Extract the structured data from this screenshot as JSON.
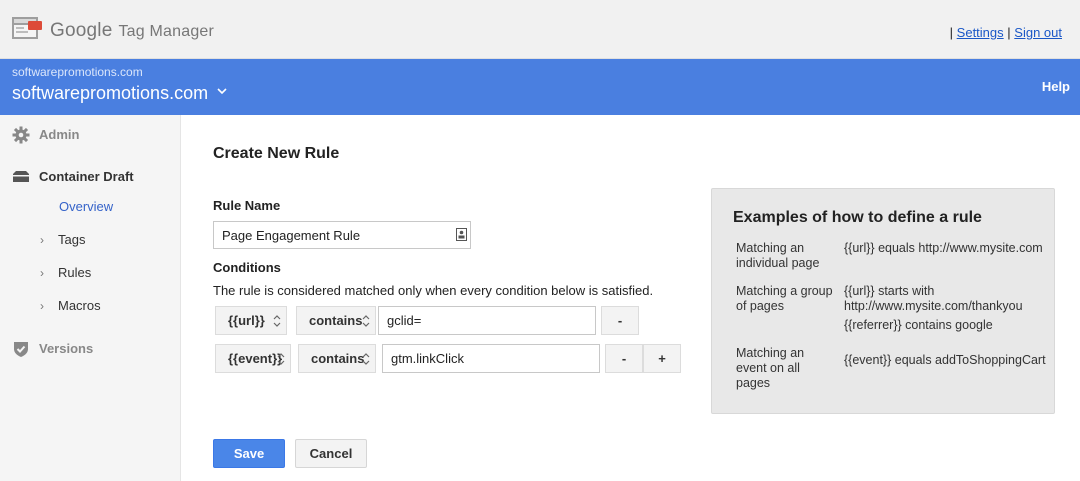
{
  "topbar": {
    "brand_google": "Google",
    "brand_product": "Tag Manager",
    "separator": "|",
    "settings_link": "Settings",
    "signout_link": "Sign out"
  },
  "account": {
    "small_name": "softwarepromotions.com",
    "container_name": "softwarepromotions.com",
    "help": "Help",
    "colors": {
      "bar": "#4a7fe0"
    }
  },
  "sidebar": {
    "admin": "Admin",
    "container_draft": "Container Draft",
    "overview": "Overview",
    "tags": "Tags",
    "rules": "Rules",
    "macros": "Macros",
    "versions": "Versions"
  },
  "main": {
    "title": "Create New Rule",
    "rule_name_label": "Rule Name",
    "rule_name_value": "Page Engagement Rule",
    "conditions_label": "Conditions",
    "conditions_desc": "The rule is considered matched only when every condition below is satisfied.",
    "conditions": [
      {
        "variable": "{{url}}",
        "operator": "contains",
        "value": "gclid=",
        "remove": "-"
      },
      {
        "variable": "{{event}}",
        "operator": "contains",
        "value": "gtm.linkClick",
        "remove": "-",
        "add": "+"
      }
    ],
    "save": "Save",
    "cancel": "Cancel"
  },
  "examples": {
    "title": "Examples of how to define a rule",
    "rows": [
      {
        "label": "Matching an individual page",
        "rule1": "{{url}} equals http://www.mysite.com"
      },
      {
        "label": "Matching a group of pages",
        "rule1": "{{url}} starts with http://www.mysite.com/thankyou",
        "rule2": "{{referrer}} contains google"
      },
      {
        "label": "Matching an event on all pages",
        "rule1": "{{event}} equals addToShoppingCart"
      }
    ]
  }
}
